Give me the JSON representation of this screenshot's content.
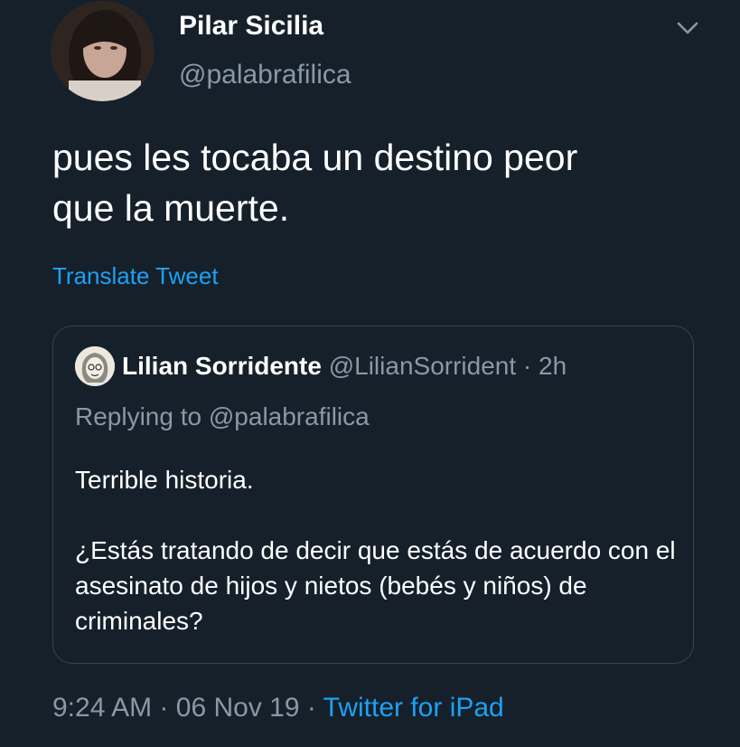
{
  "author": {
    "name": "Pilar Sicilia",
    "handle": "@palabrafilica"
  },
  "tweet": {
    "text_line1": "pues les tocaba un destino peor",
    "text_line2": "que la muerte.",
    "translate_label": "Translate Tweet"
  },
  "quoted": {
    "name": "Lilian Sorridente",
    "handle": "@LilianSorrident",
    "separator": "·",
    "time": "2h",
    "replying_prefix": "Replying to",
    "replying_handle": "@palabrafilica",
    "body_p1": "Terrible historia.",
    "body_p2": "¿Estás tratando de decir que estás de acuerdo con el asesinato de hijos y nietos (bebés y niños) de criminales?"
  },
  "meta": {
    "time": "9:24 AM",
    "sep1": "·",
    "date": "06 Nov 19",
    "sep2": "·",
    "source": "Twitter for iPad"
  },
  "icons": {
    "caret": "chevron-down-icon"
  },
  "colors": {
    "background": "#15202b",
    "secondary_text": "#8899a6",
    "link": "#1da1f2",
    "border": "#38444d"
  }
}
